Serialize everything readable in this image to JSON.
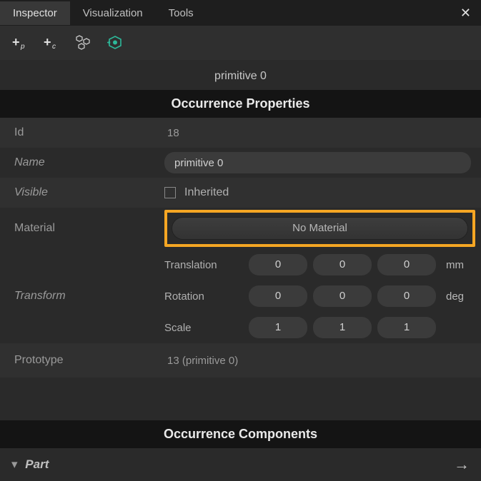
{
  "tabs": {
    "inspector": "Inspector",
    "visualization": "Visualization",
    "tools": "Tools"
  },
  "object_name": "primitive 0",
  "sections": {
    "properties": "Occurrence Properties",
    "components": "Occurrence Components"
  },
  "props": {
    "id": {
      "label": "Id",
      "value": "18"
    },
    "name": {
      "label": "Name",
      "value": "primitive 0"
    },
    "visible": {
      "label": "Visible",
      "value": "Inherited"
    },
    "material": {
      "label": "Material",
      "button": "No Material"
    },
    "transform": {
      "label": "Transform",
      "translation": {
        "label": "Translation",
        "x": "0",
        "y": "0",
        "z": "0",
        "unit": "mm"
      },
      "rotation": {
        "label": "Rotation",
        "x": "0",
        "y": "0",
        "z": "0",
        "unit": "deg"
      },
      "scale": {
        "label": "Scale",
        "x": "1",
        "y": "1",
        "z": "1",
        "unit": ""
      }
    },
    "prototype": {
      "label": "Prototype",
      "value": "13 (primitive 0)"
    }
  },
  "bottom": {
    "part": "Part"
  }
}
